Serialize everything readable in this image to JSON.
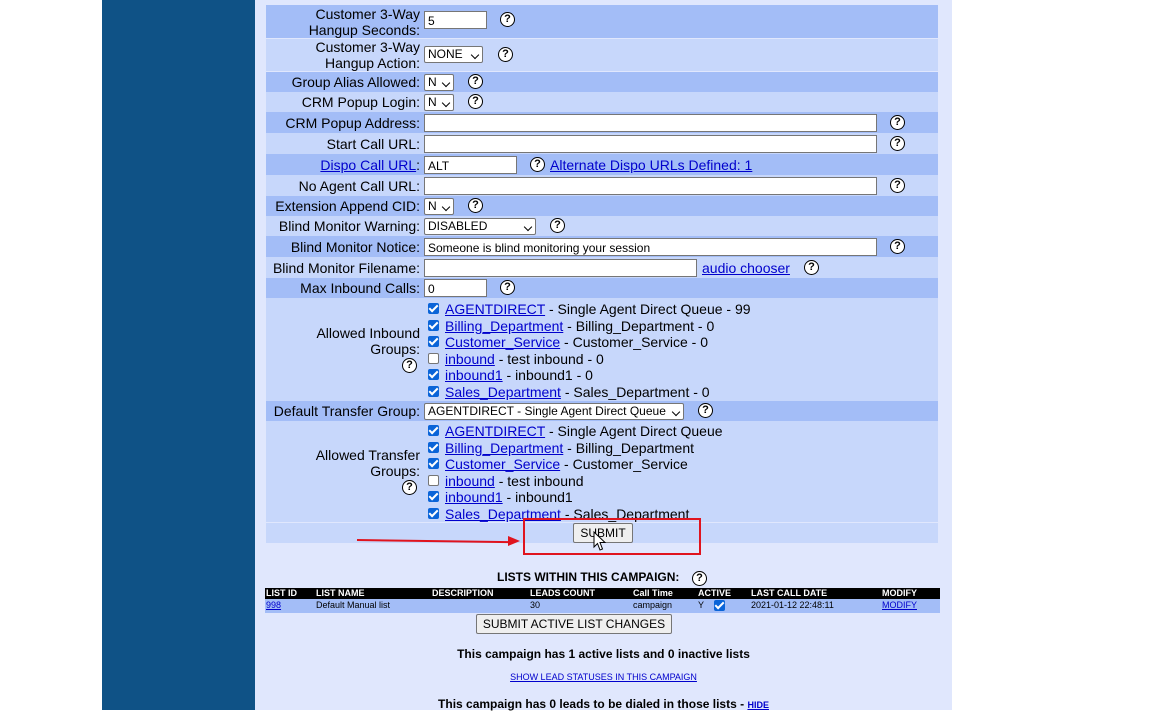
{
  "form": {
    "hangup_seconds": {
      "label": "Customer 3-Way Hangup Seconds:",
      "value": "5"
    },
    "hangup_action": {
      "label": "Customer 3-Way Hangup Action:",
      "value": "NONE"
    },
    "group_alias": {
      "label": "Group Alias Allowed:",
      "value": "N"
    },
    "crm_popup_login": {
      "label": "CRM Popup Login:",
      "value": "N"
    },
    "crm_popup_address": {
      "label": "CRM Popup Address:",
      "value": ""
    },
    "start_call_url": {
      "label": "Start Call URL:",
      "value": ""
    },
    "dispo_call_url": {
      "label": "Dispo Call URL",
      "value": "ALT",
      "alt_link": "Alternate Dispo URLs Defined: 1"
    },
    "no_agent_call_url": {
      "label": "No Agent Call URL:",
      "value": ""
    },
    "extension_append_cid": {
      "label": "Extension Append CID:",
      "value": "N"
    },
    "blind_monitor_warning": {
      "label": "Blind Monitor Warning:",
      "value": "DISABLED"
    },
    "blind_monitor_notice": {
      "label": "Blind Monitor Notice:",
      "value": "Someone is blind monitoring your session"
    },
    "blind_monitor_filename": {
      "label": "Blind Monitor Filename:",
      "value": "",
      "chooser_link": "audio chooser"
    },
    "max_inbound_calls": {
      "label": "Max Inbound Calls:",
      "value": "0"
    },
    "allowed_inbound_groups": {
      "label_line1": "Allowed Inbound",
      "label_line2": "Groups:",
      "items": [
        {
          "id": "AGENTDIRECT",
          "desc": " - Single Agent Direct Queue - 99",
          "checked": true
        },
        {
          "id": "Billing_Department",
          "desc": " - Billing_Department - 0",
          "checked": true
        },
        {
          "id": "Customer_Service",
          "desc": " - Customer_Service - 0",
          "checked": true
        },
        {
          "id": "inbound",
          "desc": " - test inbound - 0",
          "checked": false
        },
        {
          "id": "inbound1",
          "desc": " - inbound1 - 0",
          "checked": true
        },
        {
          "id": "Sales_Department",
          "desc": " - Sales_Department - 0",
          "checked": true
        }
      ]
    },
    "default_transfer_group": {
      "label": "Default Transfer Group:",
      "value": "AGENTDIRECT - Single Agent Direct Queue"
    },
    "allowed_transfer_groups": {
      "label_line1": "Allowed Transfer",
      "label_line2": "Groups:",
      "items": [
        {
          "id": "AGENTDIRECT",
          "desc": " - Single Agent Direct Queue",
          "checked": true
        },
        {
          "id": "Billing_Department",
          "desc": " - Billing_Department",
          "checked": true
        },
        {
          "id": "Customer_Service",
          "desc": " - Customer_Service",
          "checked": true
        },
        {
          "id": "inbound",
          "desc": " - test inbound",
          "checked": false
        },
        {
          "id": "inbound1",
          "desc": " - inbound1",
          "checked": true
        },
        {
          "id": "Sales_Department",
          "desc": " - Sales_Department",
          "checked": true
        }
      ]
    },
    "submit_label": "SUBMIT",
    "help_glyph": "?"
  },
  "lists": {
    "heading": "LISTS WITHIN THIS CAMPAIGN:",
    "columns": [
      "LIST ID",
      "LIST NAME",
      "DESCRIPTION",
      "LEADS COUNT",
      "Call Time",
      "ACTIVE",
      "LAST CALL DATE",
      "MODIFY"
    ],
    "rows": [
      {
        "list_id": "998",
        "list_name": "Default Manual list",
        "description": "",
        "leads_count": "30",
        "call_time": "campaign",
        "active": "Y",
        "active_checked": true,
        "last_call_date": "2021-01-12 22:48:11",
        "modify": "MODIFY"
      }
    ],
    "submit_changes_label": "SUBMIT ACTIVE LIST CHANGES",
    "summary": "This campaign has 1 active lists and 0 inactive lists",
    "show_statuses_link": "SHOW LEAD STATUSES IN THIS CAMPAIGN",
    "leads_to_dial": "This campaign has 0 leads to be dialed in those lists",
    "separator": " - ",
    "hide_link": "HIDE"
  },
  "colors": {
    "sidebar": "#0f5286",
    "panel_bg": "#e0e7fd",
    "row_dark": "#a3bdf7",
    "row_light": "#c7d7fb",
    "annotation_red": "#e0141e"
  }
}
